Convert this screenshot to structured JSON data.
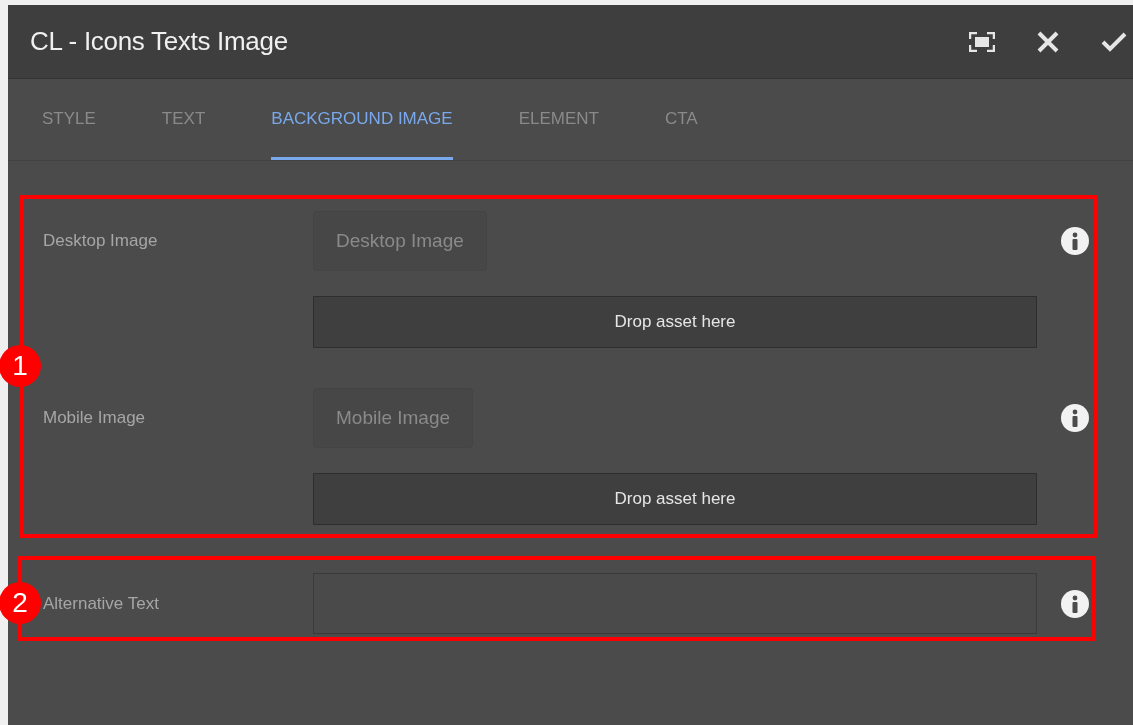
{
  "window": {
    "title": "CL - Icons Texts Image"
  },
  "header_actions": [
    {
      "kind": "fullscreen"
    },
    {
      "kind": "close"
    },
    {
      "kind": "done"
    }
  ],
  "tabs": [
    {
      "label": "STYLE",
      "selected": false
    },
    {
      "label": "TEXT",
      "selected": false
    },
    {
      "label": "BACKGROUND IMAGE",
      "selected": true
    },
    {
      "label": "ELEMENT",
      "selected": false
    },
    {
      "label": "CTA",
      "selected": false
    }
  ],
  "fields": [
    {
      "kind": "image",
      "label": "Desktop Image",
      "button": {
        "label": "Desktop Image",
        "disabled": true
      },
      "dropzone": "Drop asset here"
    },
    {
      "kind": "image",
      "label": "Mobile Image",
      "button": {
        "label": "Mobile Image",
        "disabled": true
      },
      "dropzone": "Drop asset here"
    },
    {
      "kind": "text",
      "label": "Alternative Text"
    }
  ],
  "annotations": [
    {
      "label": "1"
    },
    {
      "label": "2"
    }
  ]
}
